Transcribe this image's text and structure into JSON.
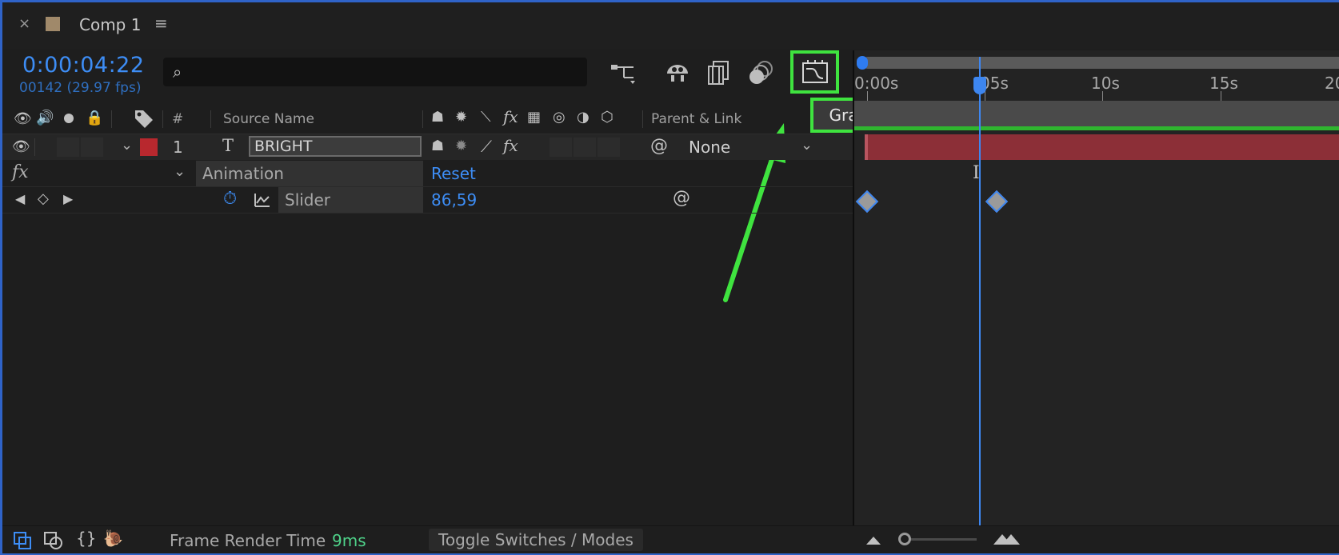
{
  "tab": {
    "close_icon": "×",
    "title": "Comp 1",
    "menu_icon": "≡"
  },
  "time": {
    "timecode": "0:00:04:22",
    "frames": "00142 (29.97 fps)"
  },
  "search": {
    "placeholder": ""
  },
  "toolbar": {
    "graph_editor_tooltip": "Graph Editor"
  },
  "columns": {
    "hash": "#",
    "source_name": "Source Name",
    "parent_link": "Parent & Link"
  },
  "layer": {
    "number": "1",
    "type_glyph": "T",
    "name": "BRIGHT",
    "parent_value": "None",
    "label_color": "#b8282e"
  },
  "effect": {
    "fx_label": "fx",
    "name": "Animation",
    "reset": "Reset"
  },
  "property": {
    "name": "Slider",
    "value": "86,59"
  },
  "timeline": {
    "ticks": [
      "0:00s",
      "05s",
      "10s",
      "15s",
      "20"
    ]
  },
  "footer": {
    "frame_render_label": "Frame Render Time",
    "frame_render_value": "9ms",
    "toggle_label": "Toggle Switches / Modes"
  },
  "colors": {
    "accent": "#3d8df5",
    "highlight": "#3fe33f",
    "layer_bar": "#8c2f37"
  }
}
